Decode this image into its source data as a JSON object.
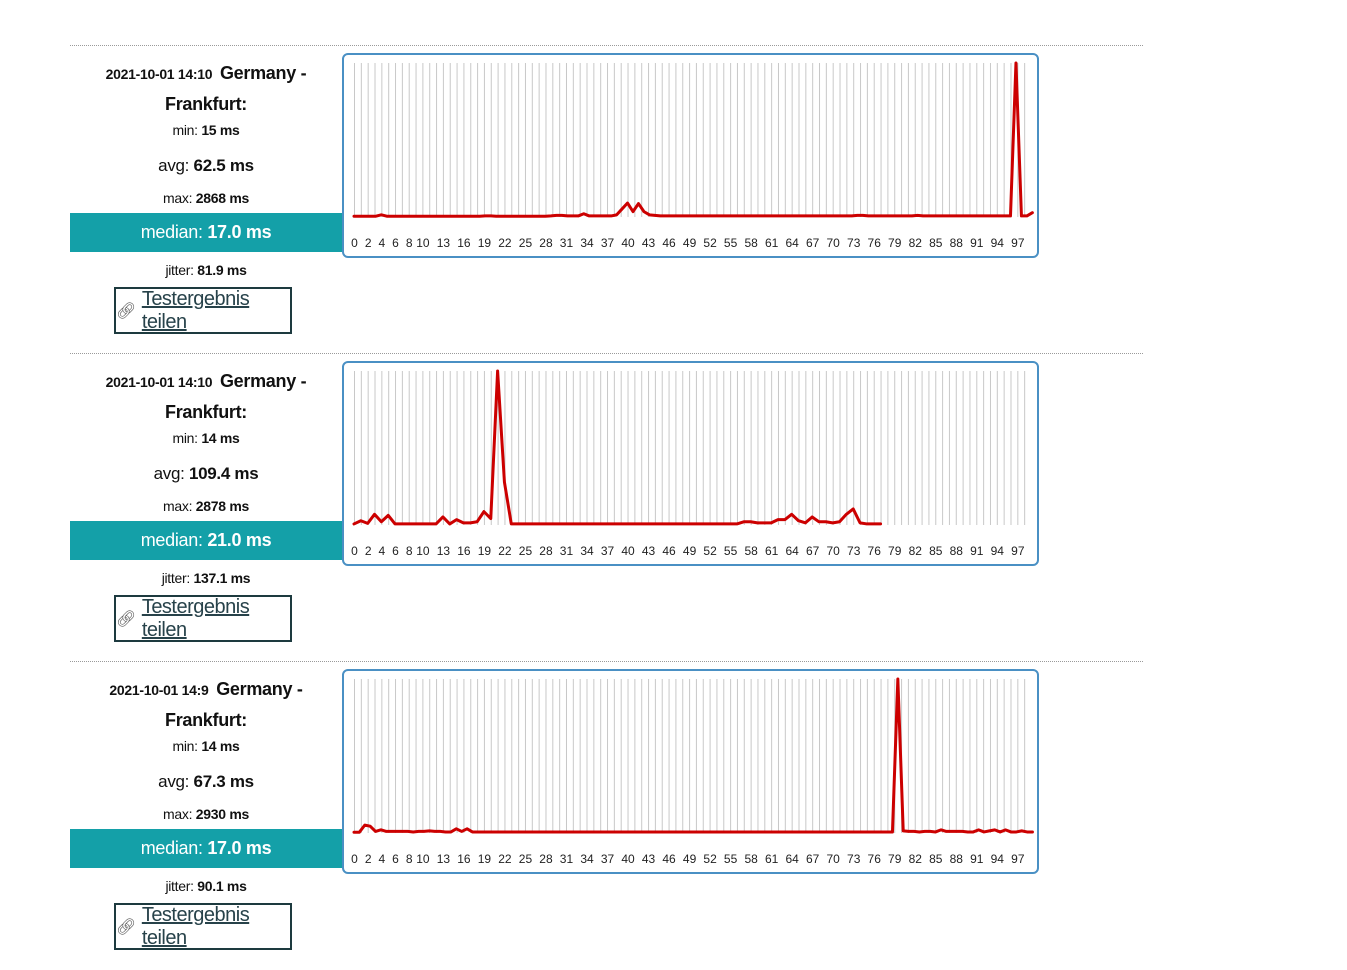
{
  "share_label": "Testergebnis teilen",
  "colors": {
    "accent": "#14a0a8",
    "line": "#cc0000",
    "grid": "#c8c8c8",
    "frame": "#4a90c4"
  },
  "results": [
    {
      "timestamp": "2021-10-01 14:10",
      "location_line1": "Germany -",
      "location_line2": "Frankfurt:",
      "min_label": "min:",
      "min_value": "15 ms",
      "avg_label": "avg:",
      "avg_value": "62.5 ms",
      "max_label": "max:",
      "max_value": "2868 ms",
      "median_label": "median:",
      "median_value": "17.0 ms",
      "jitter_label": "jitter:",
      "jitter_value": "81.9 ms",
      "chart_data": {
        "type": "line",
        "xlim": [
          0,
          99
        ],
        "ylim": [
          0,
          2868
        ],
        "x_tick_labels": [
          "0",
          "2",
          "4",
          "6",
          "8",
          "10",
          "13",
          "16",
          "19",
          "22",
          "25",
          "28",
          "31",
          "34",
          "37",
          "40",
          "43",
          "46",
          "49",
          "52",
          "55",
          "58",
          "61",
          "64",
          "67",
          "70",
          "73",
          "76",
          "79",
          "82",
          "85",
          "88",
          "91",
          "94",
          "97"
        ],
        "series": [
          {
            "values": [
              15,
              15,
              15,
              15,
              15,
              40,
              15,
              15,
              15,
              15,
              15,
              15,
              15,
              15,
              15,
              15,
              15,
              15,
              15,
              15,
              15,
              15,
              15,
              15,
              20,
              20,
              15,
              15,
              15,
              15,
              15,
              15,
              15,
              15,
              15,
              15,
              20,
              30,
              30,
              20,
              20,
              20,
              60,
              20,
              20,
              20,
              20,
              20,
              40,
              150,
              260,
              100,
              250,
              100,
              40,
              30,
              20,
              20,
              20,
              20,
              20,
              20,
              20,
              20,
              20,
              20,
              20,
              20,
              20,
              20,
              20,
              20,
              20,
              20,
              20,
              20,
              20,
              20,
              20,
              20,
              20,
              20,
              20,
              20,
              20,
              20,
              20,
              20,
              20,
              20,
              20,
              20,
              30,
              30,
              20,
              20,
              20,
              20,
              20,
              20,
              20,
              20,
              20,
              30,
              20,
              20,
              20,
              20,
              20,
              20,
              20,
              20,
              20,
              20,
              20,
              20,
              20,
              20,
              20,
              20,
              20,
              2868,
              20,
              20,
              80
            ]
          }
        ]
      }
    },
    {
      "timestamp": "2021-10-01 14:10",
      "location_line1": "Germany -",
      "location_line2": "Frankfurt:",
      "min_label": "min:",
      "min_value": "14 ms",
      "avg_label": "avg:",
      "avg_value": "109.4 ms",
      "max_label": "max:",
      "max_value": "2878 ms",
      "median_label": "median:",
      "median_value": "21.0 ms",
      "jitter_label": "jitter:",
      "jitter_value": "137.1 ms",
      "chart_data": {
        "type": "line",
        "xlim": [
          0,
          99
        ],
        "ylim": [
          0,
          2878
        ],
        "x_tick_labels": [
          "0",
          "2",
          "4",
          "6",
          "8",
          "10",
          "13",
          "16",
          "19",
          "22",
          "25",
          "28",
          "31",
          "34",
          "37",
          "40",
          "43",
          "46",
          "49",
          "52",
          "55",
          "58",
          "61",
          "64",
          "67",
          "70",
          "73",
          "76",
          "79",
          "82",
          "85",
          "88",
          "91",
          "94",
          "97"
        ],
        "series": [
          {
            "values": [
              20,
              80,
              30,
              200,
              60,
              180,
              20,
              20,
              20,
              20,
              20,
              20,
              20,
              150,
              20,
              100,
              40,
              40,
              60,
              250,
              120,
              2878,
              800,
              20,
              20,
              20,
              20,
              20,
              20,
              20,
              20,
              20,
              20,
              20,
              20,
              20,
              20,
              20,
              20,
              20,
              20,
              20,
              20,
              20,
              20,
              20,
              20,
              20,
              20,
              20,
              20,
              20,
              20,
              20,
              20,
              20,
              20,
              60,
              60,
              40,
              40,
              40,
              100,
              100,
              200,
              80,
              40,
              150,
              60,
              60,
              40,
              60,
              200,
              300,
              40,
              20,
              20,
              20
            ]
          }
        ]
      }
    },
    {
      "timestamp": "2021-10-01 14:9",
      "location_line1": "Germany -",
      "location_line2": "Frankfurt:",
      "min_label": "min:",
      "min_value": "14 ms",
      "avg_label": "avg:",
      "avg_value": "67.3 ms",
      "max_label": "max:",
      "max_value": "2930 ms",
      "median_label": "median:",
      "median_value": "17.0 ms",
      "jitter_label": "jitter:",
      "jitter_value": "90.1 ms",
      "chart_data": {
        "type": "line",
        "xlim": [
          0,
          99
        ],
        "ylim": [
          0,
          2930
        ],
        "x_tick_labels": [
          "0",
          "2",
          "4",
          "6",
          "8",
          "10",
          "13",
          "16",
          "19",
          "22",
          "25",
          "28",
          "31",
          "34",
          "37",
          "40",
          "43",
          "46",
          "49",
          "52",
          "55",
          "58",
          "61",
          "64",
          "67",
          "70",
          "73",
          "76",
          "79",
          "82",
          "85",
          "88",
          "91",
          "94",
          "97"
        ],
        "series": [
          {
            "values": [
              15,
              15,
              150,
              130,
              30,
              60,
              30,
              30,
              30,
              30,
              30,
              20,
              30,
              30,
              40,
              30,
              30,
              20,
              20,
              80,
              30,
              80,
              20,
              20,
              20,
              20,
              20,
              20,
              20,
              20,
              20,
              20,
              20,
              20,
              20,
              20,
              20,
              20,
              20,
              20,
              20,
              20,
              20,
              20,
              20,
              20,
              20,
              20,
              20,
              20,
              20,
              20,
              20,
              20,
              20,
              20,
              20,
              20,
              20,
              20,
              20,
              20,
              20,
              20,
              20,
              20,
              20,
              20,
              20,
              20,
              20,
              20,
              20,
              20,
              20,
              20,
              20,
              20,
              20,
              20,
              20,
              20,
              20,
              20,
              20,
              20,
              20,
              20,
              20,
              20,
              20,
              20,
              20,
              20,
              20,
              20,
              20,
              20,
              20,
              20,
              20,
              2930,
              40,
              30,
              30,
              20,
              30,
              30,
              20,
              60,
              30,
              30,
              30,
              30,
              20,
              20,
              60,
              20,
              40,
              60,
              20,
              60,
              20,
              20,
              40,
              20,
              20
            ]
          }
        ]
      }
    }
  ]
}
